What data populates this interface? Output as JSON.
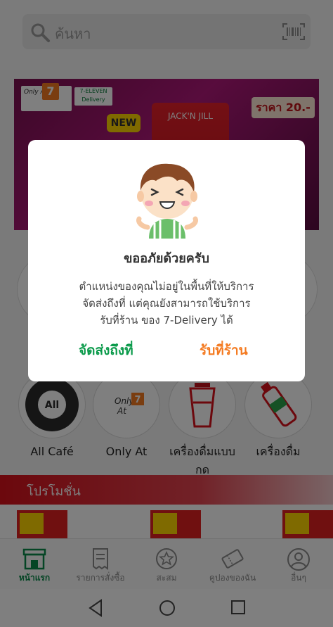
{
  "search": {
    "placeholder": "ค้นหา",
    "icon": "search-icon",
    "barcode_icon": "barcode-icon"
  },
  "banner": {
    "only_at": "Only At",
    "seven_logo": "7",
    "delivery_logo": "7-ELEVEN Delivery",
    "new_badge": "NEW",
    "product_text": "JACK'N JILL",
    "price": "ราคา 20.-"
  },
  "categories": [
    {
      "label": "All Café",
      "icon": "all-cafe-icon"
    },
    {
      "label": "Only At",
      "icon": "only-at-icon"
    },
    {
      "label": "เครื่องดื่มแบบกด",
      "icon": "fountain-cup-icon"
    },
    {
      "label": "เครื่องดื่ม",
      "icon": "bottle-icon"
    }
  ],
  "promo": {
    "title": "โปรโมชั่น"
  },
  "bottom_nav": [
    {
      "label": "หน้าแรก",
      "icon": "store-icon",
      "active": true
    },
    {
      "label": "รายการสั่งซื้อ",
      "icon": "receipt-icon",
      "active": false
    },
    {
      "label": "สะสม",
      "icon": "star-icon",
      "active": false
    },
    {
      "label": "คูปองของฉัน",
      "icon": "coupon-icon",
      "active": false
    },
    {
      "label": "อื่นๆ",
      "icon": "profile-icon",
      "active": false
    }
  ],
  "dialog": {
    "title": "ขออภัยด้วยครับ",
    "message_line1": "ตำแหน่งของคุณไม่อยู่ในพื้นที่ให้บริการ",
    "message_line2": "จัดส่งถึงที่ แต่คุณยังสามารถใช้บริการ",
    "message_line3": "รับที่ร้าน ของ 7-Delivery ได้",
    "delivery_button": "จัดส่งถึงที่",
    "pickup_button": "รับที่ร้าน",
    "colors": {
      "delivery": "#0a9a4a",
      "pickup": "#f47a20"
    }
  }
}
